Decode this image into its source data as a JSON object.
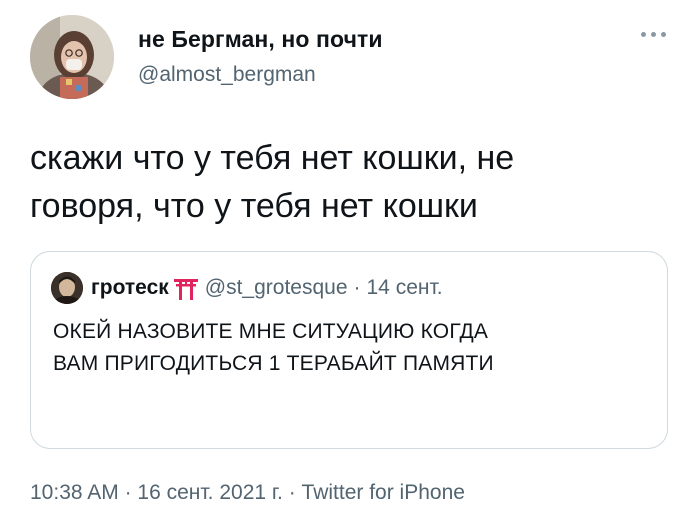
{
  "author": {
    "display_name": "не Бергман, но почти",
    "handle": "@almost_bergman"
  },
  "tweet": {
    "text_line1": "скажи что у тебя нет кошки, не",
    "text_line2": "говоря, что у тебя нет кошки"
  },
  "quoted_tweet": {
    "display_name": "гротеск",
    "emoji_icon": "torii-gate-icon",
    "handle": "@st_grotesque",
    "separator": "·",
    "date": "14 сент.",
    "text_line1": "ОКЕЙ НАЗОВИТЕ МНЕ СИТУАЦИЮ КОГДА",
    "text_line2": "ВАМ ПРИГОДИТЬСЯ 1 ТЕРАБАЙТ ПАМЯТИ"
  },
  "meta": {
    "time": "10:38 AM",
    "separator1": "·",
    "date": "16 сент. 2021 г.",
    "separator2": "·",
    "source": "Twitter for iPhone"
  },
  "colors": {
    "text": "#0f1419",
    "secondary": "#536471",
    "border": "#cfd9de",
    "torii": "#e0245e"
  }
}
